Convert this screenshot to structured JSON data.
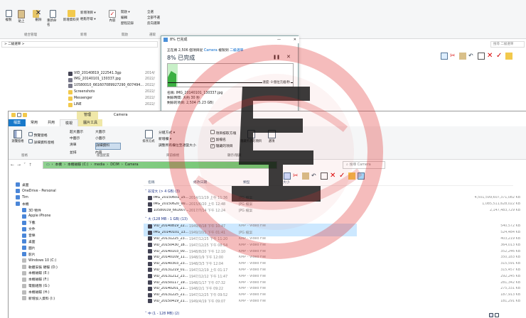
{
  "back_window": {
    "ribbon": {
      "buttons": [
        "複製",
        "貼上",
        "移動",
        "刪除",
        "重新命名",
        "新增資料夾",
        "內容"
      ],
      "small_items": [
        "新增項目 ▾",
        "輕鬆存取 ▾",
        "開啟 ▾",
        "編輯",
        "歷程記錄",
        "全選",
        "全部不選",
        "反向選擇"
      ],
      "groups": [
        "組合管理",
        "新增",
        "開啟",
        "選取"
      ]
    },
    "breadcrumb": "> 二級選單 >",
    "files": [
      {
        "name": "VID_20140819_222541.3gp",
        "date": "2014/"
      },
      {
        "name": "IMG_20140101_130337.jpg",
        "date": "2022/"
      },
      {
        "name": "10580010_661607089927290_607494...",
        "date": "2022/"
      },
      {
        "name": "Screenshots",
        "date": "2022/"
      },
      {
        "name": "Messenger",
        "date": "2022/"
      },
      {
        "name": "LINE",
        "date": "2022/"
      }
    ],
    "search_placeholder": "搜尋 二級選單"
  },
  "copy_dialog": {
    "title": "8% 已完成",
    "status_line_prefix": "正在將 2,506 個項目從",
    "source": "Camera",
    "mid": "複製到",
    "dest": "二級選單",
    "percent_text": "8% 已完成",
    "speed": "速度: 0 個位元組/秒",
    "name_label": "名稱: IMG_20140101_130337.jpg",
    "time_left": "剩餘時間: 大約 30 秒",
    "items_left": "剩餘的項目: 2,504 (5.23 GB)",
    "less_details": "較少的詳細資料",
    "progress_fraction": 0.08
  },
  "front_window": {
    "context_tab": "管理",
    "title_tab": "Camera",
    "tabs": [
      "檔案",
      "常用",
      "共用",
      "檢視",
      "圖片工具"
    ],
    "ribbon": {
      "pane": [
        "瀏覽窗格",
        "預覽窗格",
        "詳細資料窗格"
      ],
      "layout": [
        "超大圖示",
        "大圖示",
        "中圖示",
        "小圖示",
        "清單",
        "詳細資料",
        "並排",
        "內容"
      ],
      "sort": "排序方式",
      "current": [
        "分組方式 ▾",
        "新增欄 ▾",
        "調整所有欄位至適當大小"
      ],
      "show": [
        "項目核取方塊",
        "副檔名",
        "隱藏的項目"
      ],
      "hide_label": "隱藏所選的項目",
      "options": "選項",
      "groups": [
        "窗格",
        "版面配置",
        "目前檢視",
        "顯示/隱藏"
      ]
    },
    "path": [
      "本機",
      "本機磁碟 (C:)",
      "media",
      "DCIM",
      "Camera"
    ],
    "search_placeholder": "搜尋 Camera",
    "columns": [
      "名稱",
      "修改日期",
      "類型",
      "大小"
    ],
    "group_huge": "非常大 (> 4 GB) (3)",
    "group_big": "大 (128 MB - 1 GB) (13)",
    "group_bottom": "中 (1 - 128 MB) (2)",
    "huge_files": [
      {
        "name": "IMG_20150601_15...",
        "date": "2014/11/19 上午 11:36",
        "type": "JPG 檔案",
        "size": "4,501,599,607,371,082 KB"
      },
      {
        "name": "IMG_20150620_00...",
        "date": "2015/6/20 上午 12:48",
        "type": "JPG 檔案",
        "size": "1,085,511,628,022 KB"
      },
      {
        "name": "10580039_661607...",
        "date": "2017/7/14 下午 12:24",
        "type": "JPG 檔案",
        "size": "2,147,483,729 KB"
      }
    ],
    "big_files": [
      {
        "name": "VID_20140819_22...",
        "date": "1949/8/18 下午 10:47",
        "type": "KMP - Video File",
        "size": "540,572 KB",
        "selected": true
      },
      {
        "name": "IMG_20140101_13...",
        "date": "1949/10/1 下午 01:41",
        "type": "JPG 檔案",
        "size": "524,484 KB",
        "selected": true
      },
      {
        "name": "VID_20131225_23...",
        "date": "1947/12/25 下午 11:20",
        "type": "KMP - Video File",
        "size": "403,219 KB"
      },
      {
        "name": "VID_20150430_18...",
        "date": "1947/12/25 下午 08:54",
        "type": "KMP - Video File",
        "size": "364,013 KB"
      },
      {
        "name": "VID_20140103_00...",
        "date": "1948/8/20 下午 12:10",
        "type": "KMP - Video File",
        "size": "352,246 KB"
      },
      {
        "name": "VID_20140109_11...",
        "date": "1948/1/9 下午 12:00",
        "type": "KMP - Video File",
        "size": "350,183 KB"
      },
      {
        "name": "VID_20140303_23...",
        "date": "1948/3/3 下午 12:04",
        "type": "KMP - Video File",
        "size": "315,591 KB"
      },
      {
        "name": "VID_20131219_01...",
        "date": "1947/12/19 上午 01:17",
        "type": "KMP - Video File",
        "size": "315,457 KB"
      },
      {
        "name": "VID_20131212_23...",
        "date": "1947/12/12 下午 11:47",
        "type": "KMP - Video File",
        "size": "292,245 KB"
      },
      {
        "name": "VID_20150117_19...",
        "date": "1948/1/17 下午 07:32",
        "type": "KMP - Video File",
        "size": "281,342 KB"
      },
      {
        "name": "VID_20140201_21...",
        "date": "1948/2/1 下午 09:22",
        "type": "KMP - Video File",
        "size": "275,331 KB"
      },
      {
        "name": "VID_20131225_21...",
        "date": "1947/12/25 下午 09:52",
        "type": "KMP - Video File",
        "size": "187,913 KB"
      },
      {
        "name": "VID_20150419_21...",
        "date": "1949/4/19 下午 09:07",
        "type": "KMP - Video File",
        "size": "181,291 KB"
      }
    ],
    "nav": [
      {
        "label": "桌面",
        "indent": 1
      },
      {
        "label": "OneDrive - Personal",
        "indent": 1
      },
      {
        "label": "Tim",
        "indent": 1
      },
      {
        "label": "本機",
        "indent": 1
      },
      {
        "label": "3D 物件",
        "indent": 2
      },
      {
        "label": "Apple iPhone",
        "indent": 2
      },
      {
        "label": "下載",
        "indent": 2
      },
      {
        "label": "文件",
        "indent": 2
      },
      {
        "label": "音樂",
        "indent": 2
      },
      {
        "label": "桌面",
        "indent": 2
      },
      {
        "label": "圖片",
        "indent": 2
      },
      {
        "label": "影片",
        "indent": 2
      },
      {
        "label": "Windows 10 (C:)",
        "indent": 2
      },
      {
        "label": "軟體安裝 硬碟 (D:)",
        "indent": 2
      },
      {
        "label": "本機磁碟 (E:)",
        "indent": 2
      },
      {
        "label": "本機磁碟 (F:)",
        "indent": 2
      },
      {
        "label": "電腦組態 (G:)",
        "indent": 2
      },
      {
        "label": "本機磁碟 (H:)",
        "indent": 2
      },
      {
        "label": "新增加入資料 (I:)",
        "indent": 2
      }
    ]
  },
  "colors": {
    "accent": "#0078d7",
    "ribbon_green": "#4caf50",
    "watermark": "#e03030",
    "mgmt_tab": "#f0e8a8"
  }
}
